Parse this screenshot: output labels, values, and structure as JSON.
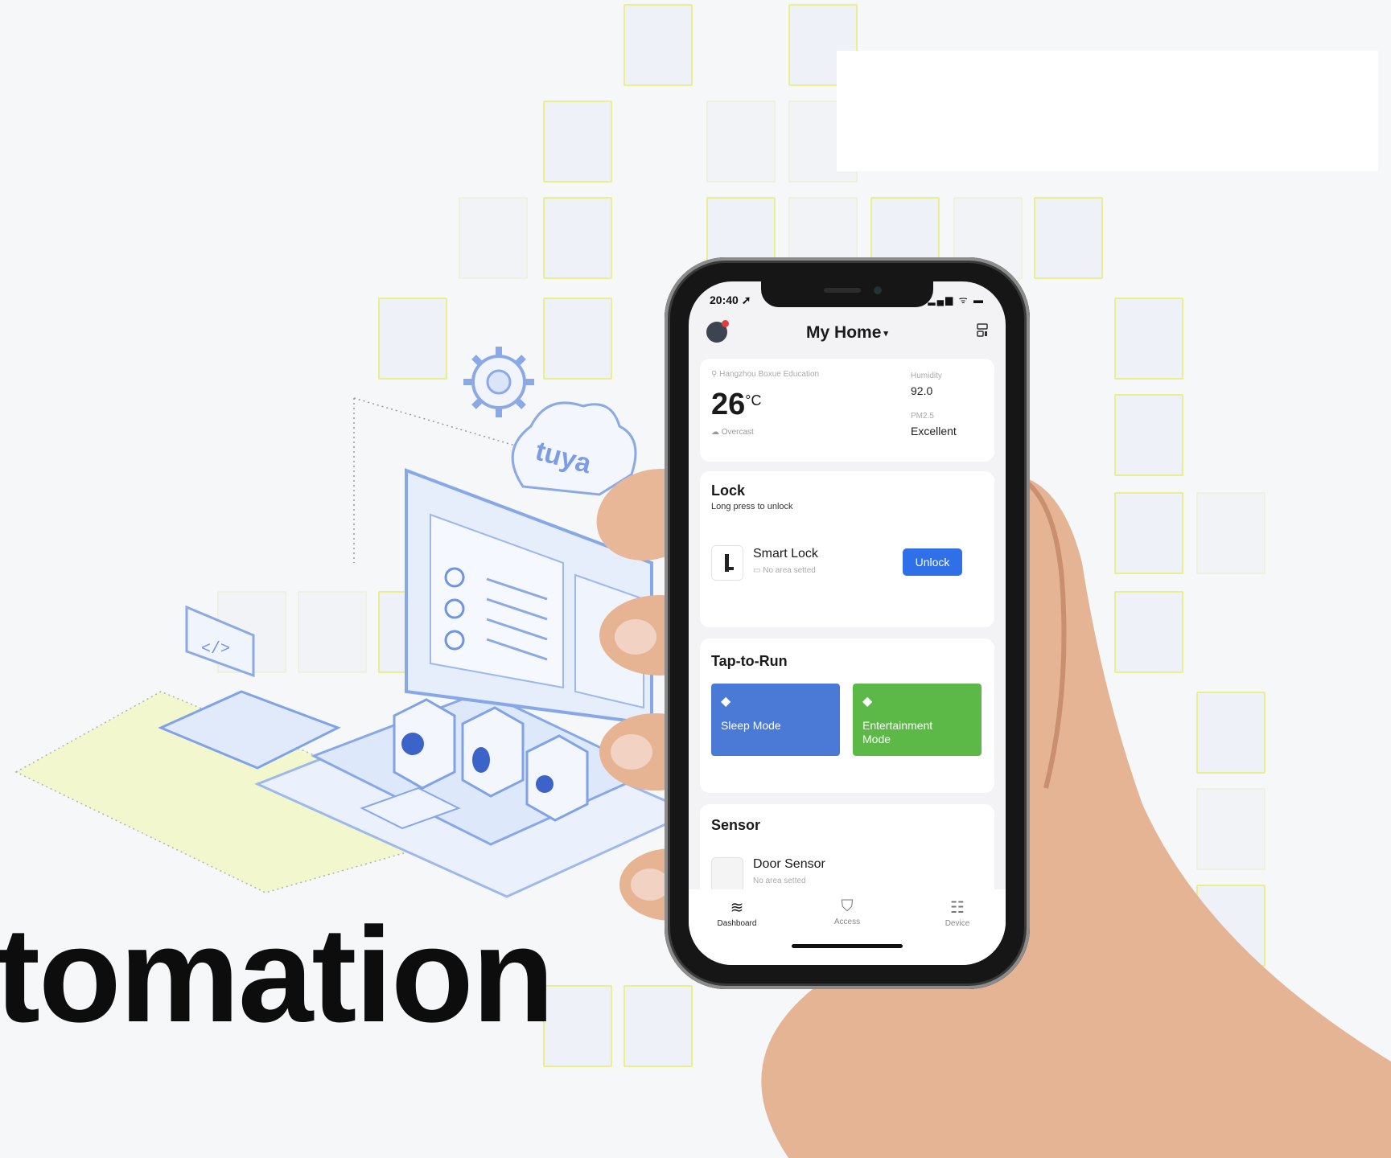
{
  "headline": "tomation",
  "status_bar": {
    "time": "20:40 ➚",
    "icons": "▂▄▆ ᯤ ▬"
  },
  "header": {
    "title": "My Home",
    "caret": "▾",
    "avatar_icon": "avatar-icon",
    "menu_icon": "list-view-icon"
  },
  "weather": {
    "location": "Hangzhou Boxue Education",
    "temperature": "26",
    "unit": "°C",
    "condition": "Overcast",
    "humidity_label": "Humidity",
    "humidity_value": "92.0",
    "pm_label": "PM2.5",
    "pm_value": "Excellent"
  },
  "lock": {
    "title": "Lock",
    "subtitle": "Long press to unlock",
    "device_name": "Smart Lock",
    "device_area": "No area setted",
    "button_label": "Unlock"
  },
  "tap_to_run": {
    "title": "Tap-to-Run",
    "scenes": [
      {
        "label": "Sleep Mode",
        "color": "#4a79d6",
        "icon": "tag-icon"
      },
      {
        "label": "Entertainment Mode",
        "color": "#5cb947",
        "icon": "tag-icon"
      }
    ]
  },
  "sensor": {
    "title": "Sensor",
    "device_name": "Door Sensor",
    "device_area": "No area setted"
  },
  "tabbar": {
    "tabs": [
      {
        "label": "Dashboard",
        "icon": "layers-icon",
        "active": true
      },
      {
        "label": "Access",
        "icon": "shield-icon",
        "active": false
      },
      {
        "label": "Device",
        "icon": "device-icon",
        "active": false
      }
    ]
  },
  "illustration": {
    "logo_text": "tuya",
    "code_glyph": "</>"
  },
  "colors": {
    "accent": "#2f6fe8",
    "sleep": "#4a79d6",
    "entertainment": "#5cb947",
    "tile_border": "#e9ef8c"
  }
}
